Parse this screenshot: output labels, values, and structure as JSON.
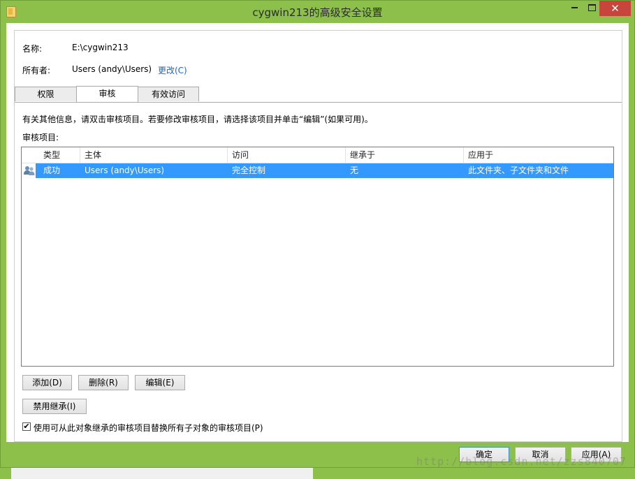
{
  "window": {
    "title": "cygwin213的高级安全设置",
    "close_glyph": "✕"
  },
  "info": {
    "name_label": "名称:",
    "name_value": "E:\\cygwin213",
    "owner_label": "所有者:",
    "owner_value": "Users (andy\\Users)",
    "change_link": "更改(C)"
  },
  "tabs": [
    {
      "label": "权限"
    },
    {
      "label": "审核"
    },
    {
      "label": "有效访问"
    }
  ],
  "active_tab": "审核",
  "description": "有关其他信息，请双击审核项目。若要修改审核项目，请选择该项目并单击“编辑”(如果可用)。",
  "list_label": "审核项目:",
  "columns": [
    "类型",
    "主体",
    "访问",
    "继承于",
    "应用于"
  ],
  "rows": [
    {
      "type": "成功",
      "principal": "Users (andy\\Users)",
      "access": "完全控制",
      "inherited_from": "无",
      "applies_to": "此文件夹、子文件夹和文件"
    }
  ],
  "buttons": {
    "add": "添加(D)",
    "remove": "删除(R)",
    "edit": "编辑(E)",
    "disable_inheritance": "禁用继承(I)"
  },
  "replace_checkbox": {
    "checked": true,
    "label": "使用可从此对象继承的审核项目替换所有子对象的审核项目(P)"
  },
  "dialog_buttons": {
    "ok": "确定",
    "cancel": "取消",
    "apply": "应用(A)"
  },
  "watermark": "http://blog.csdn.net/zzs840707",
  "colors": {
    "title_bar": "#8cc04b",
    "selection": "#3399ff",
    "close_button": "#c7453a",
    "link": "#1b66c9"
  }
}
